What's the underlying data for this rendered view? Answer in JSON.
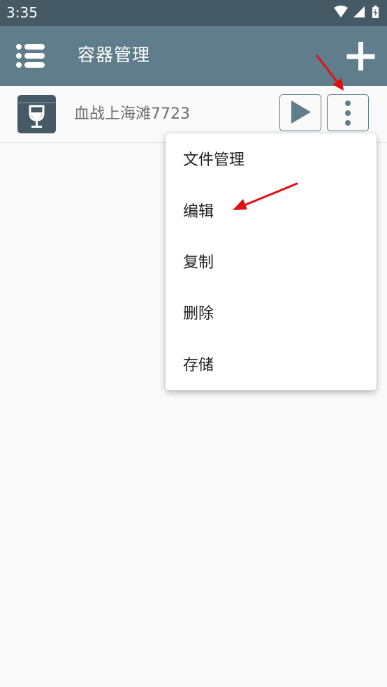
{
  "status_bar": {
    "time": "3:35",
    "icons": [
      "wifi-icon",
      "signal-icon",
      "battery-charging-icon"
    ]
  },
  "app_bar": {
    "title": "容器管理",
    "menu_icon": "menu-list-icon",
    "add_icon": "plus-icon"
  },
  "containers": [
    {
      "name": "血战上海滩7723",
      "icon": "wine-glass-box-icon"
    }
  ],
  "popup_menu": {
    "items": [
      {
        "label": "文件管理"
      },
      {
        "label": "编辑"
      },
      {
        "label": "复制"
      },
      {
        "label": "删除"
      },
      {
        "label": "存储"
      }
    ]
  },
  "colors": {
    "status_bar": "#455a64",
    "app_bar": "#607d8b",
    "background": "#fafafa",
    "annotation_arrow": "#e01010"
  }
}
